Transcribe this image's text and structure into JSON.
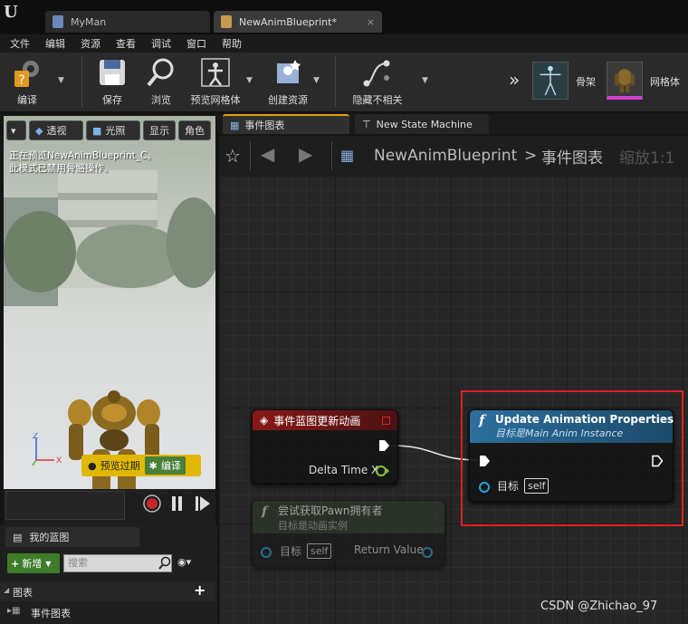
{
  "tabs": [
    {
      "label": "MyMan"
    },
    {
      "label": "NewAnimBlueprint*",
      "close": "×"
    }
  ],
  "menu": [
    "文件",
    "编辑",
    "资源",
    "查看",
    "调试",
    "窗口",
    "帮助"
  ],
  "toolbar": {
    "compile": "编译",
    "save": "保存",
    "browse": "浏览",
    "preview_mesh": "预览网格体",
    "create_asset": "创建资源",
    "hide_unrelated": "隐藏不相关",
    "skeleton": "骨架",
    "mesh": "网格体",
    "more": "»"
  },
  "viewport": {
    "perspective": "透视",
    "lit": "光照",
    "show": "显示",
    "character": "角色",
    "info_line1": "正在预览NewAnimBlueprint_C。",
    "info_line2": "此模式已禁用骨骼操作。",
    "preview_stale": "预览过期",
    "compile": "编译"
  },
  "my_blueprint": {
    "tab_label": "我的蓝图",
    "add_new": "新增",
    "search_placeholder": "搜索",
    "graphs": "图表",
    "event_graph": "事件图表",
    "add_symbol": "+"
  },
  "graph": {
    "tab_event_graph": "事件图表",
    "tab_state_machine": "New State Machine",
    "breadcrumb_root": "NewAnimBlueprint",
    "breadcrumb_sep": ">",
    "breadcrumb_current": "事件图表",
    "zoom": "缩放1:1",
    "nodes": {
      "event": {
        "title": "事件蓝图更新动画",
        "pin_delta": "Delta Time X"
      },
      "update": {
        "title": "Update Animation Properties",
        "subtitle": "目标是Main Anim Instance",
        "pin_target": "目标",
        "self": "self"
      },
      "try_get": {
        "title": "尝试获取Pawn拥有者",
        "subtitle": "目标是动画实例",
        "pin_target": "目标",
        "self": "self",
        "pin_return": "Return Value"
      }
    }
  },
  "watermark": "CSDN @Zhichao_97",
  "colors": {
    "highlight": "#e02020",
    "event_header": "#8a1818",
    "function_header": "#2c6f9e",
    "pin_exec": "#ffffff",
    "pin_float": "#8ac43f",
    "pin_object": "#2aa3d8"
  }
}
